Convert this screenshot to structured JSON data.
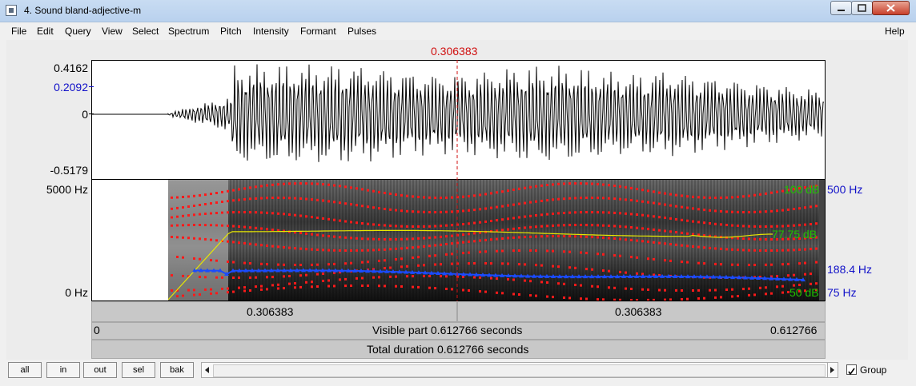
{
  "window": {
    "title": "4. Sound bland-adjective-m"
  },
  "menu": {
    "items": [
      "File",
      "Edit",
      "Query",
      "View",
      "Select",
      "Spectrum",
      "Pitch",
      "Intensity",
      "Formant",
      "Pulses"
    ],
    "help": "Help"
  },
  "cursor": {
    "time_label": "0.306383",
    "color": "#d01010"
  },
  "waveform": {
    "y_max": "0.4162",
    "y_cursor": "0.2092",
    "y_zero": "0",
    "y_min": "-0.5179"
  },
  "spectrogram": {
    "freq_top": "5000 Hz",
    "freq_bottom": "0 Hz",
    "intensity_top": "100 dB",
    "intensity_mid": "77.75 dB",
    "intensity_bottom": "50 dB",
    "pitch_top": "500 Hz",
    "pitch_current": "188.4 Hz",
    "pitch_bottom": "75 Hz"
  },
  "timebar": {
    "left_segment": "0.306383",
    "right_segment": "0.306383",
    "visible_start": "0",
    "visible_label": "Visible part 0.612766 seconds",
    "visible_end": "0.612766",
    "total_label": "Total duration 0.612766 seconds"
  },
  "buttons": {
    "all": "all",
    "in": "in",
    "out": "out",
    "sel": "sel",
    "bak": "bak"
  },
  "group": {
    "label": "Group",
    "checked": true
  },
  "colors": {
    "pitch": "#1a4bff",
    "intensity": "#e8e800",
    "formant": "#ff1a1a",
    "label_blue": "#1010c8",
    "label_green": "#20c000"
  }
}
